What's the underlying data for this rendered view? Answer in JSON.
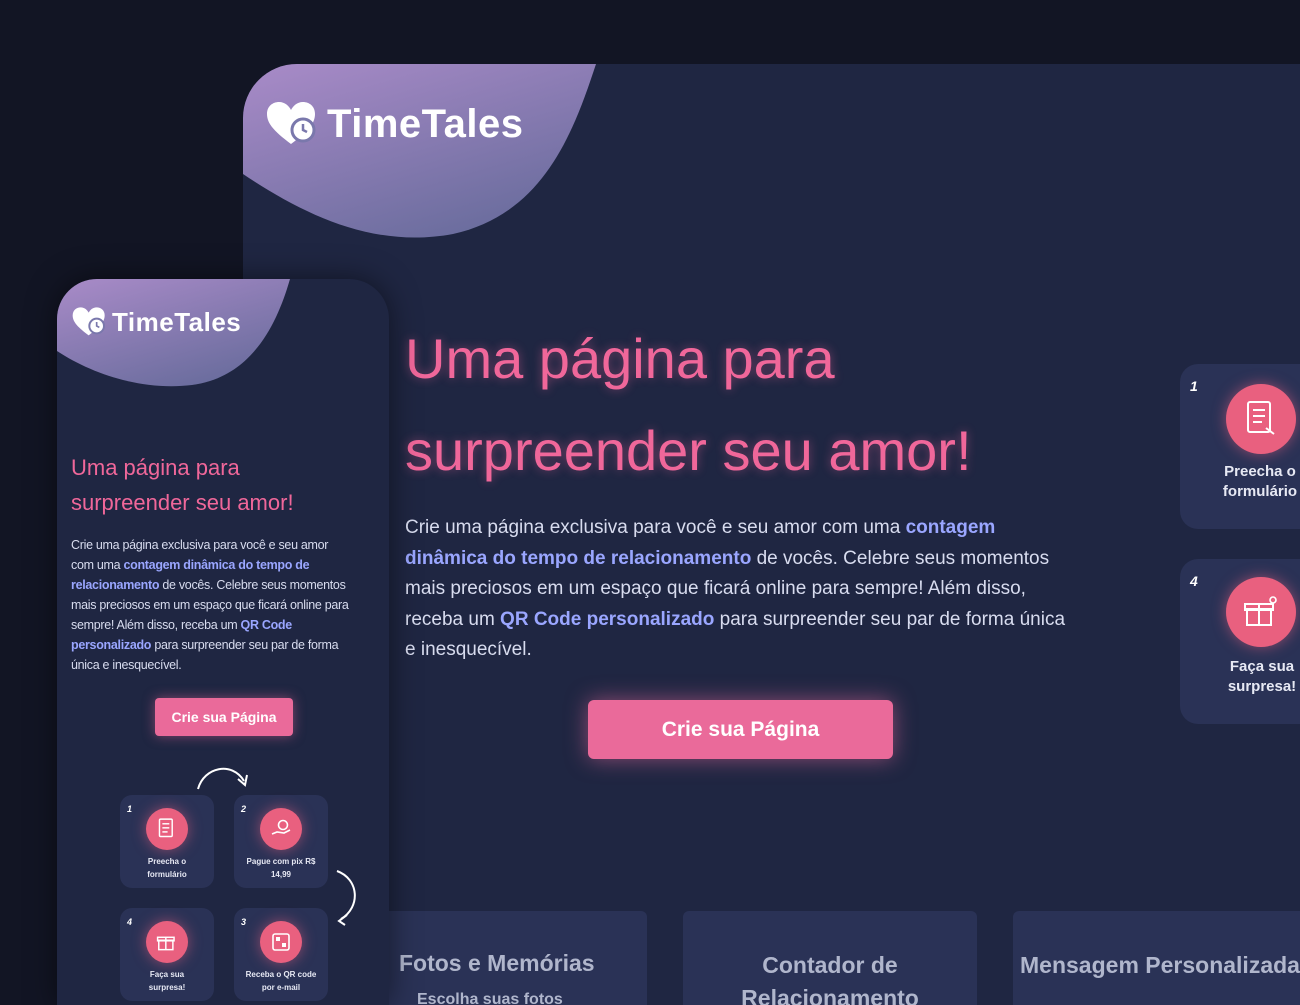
{
  "brand": {
    "name": "TimeTales"
  },
  "hero": {
    "title_line1": "Uma página para",
    "title_line2": "surpreender seu amor!",
    "desc_1": "Crie uma página exclusiva para você e seu amor com uma ",
    "desc_hl1": "contagem dinâmica do tempo de relacionamento",
    "desc_2": " de vocês. Celebre seus momentos mais preciosos em um espaço que ficará online para sempre! Além disso, receba um ",
    "desc_hl2": "QR Code personalizado",
    "desc_3": " para surpreender seu par de forma única e inesquecível.",
    "cta": "Crie sua Página"
  },
  "steps": [
    {
      "num": "1",
      "label": "Preecha o formulário",
      "icon": "form-icon"
    },
    {
      "num": "2",
      "label": "Pague com pix R$ 14,99",
      "icon": "payment-icon"
    },
    {
      "num": "3",
      "label": "Receba o QR code por e-mail",
      "icon": "qr-code-icon"
    },
    {
      "num": "4",
      "label": "Faça sua surpresa!",
      "icon": "gift-icon"
    }
  ],
  "features": [
    {
      "title": "Fotos e Memórias",
      "subtitle": "Escolha suas fotos"
    },
    {
      "title": "Contador de Relacionamento"
    },
    {
      "title": "Mensagem Personalizada"
    }
  ],
  "colors": {
    "background": "#121524",
    "panel": "#1f2642",
    "card": "#2a3256",
    "accent": "#f0679a",
    "highlight": "#9aa6ff"
  }
}
